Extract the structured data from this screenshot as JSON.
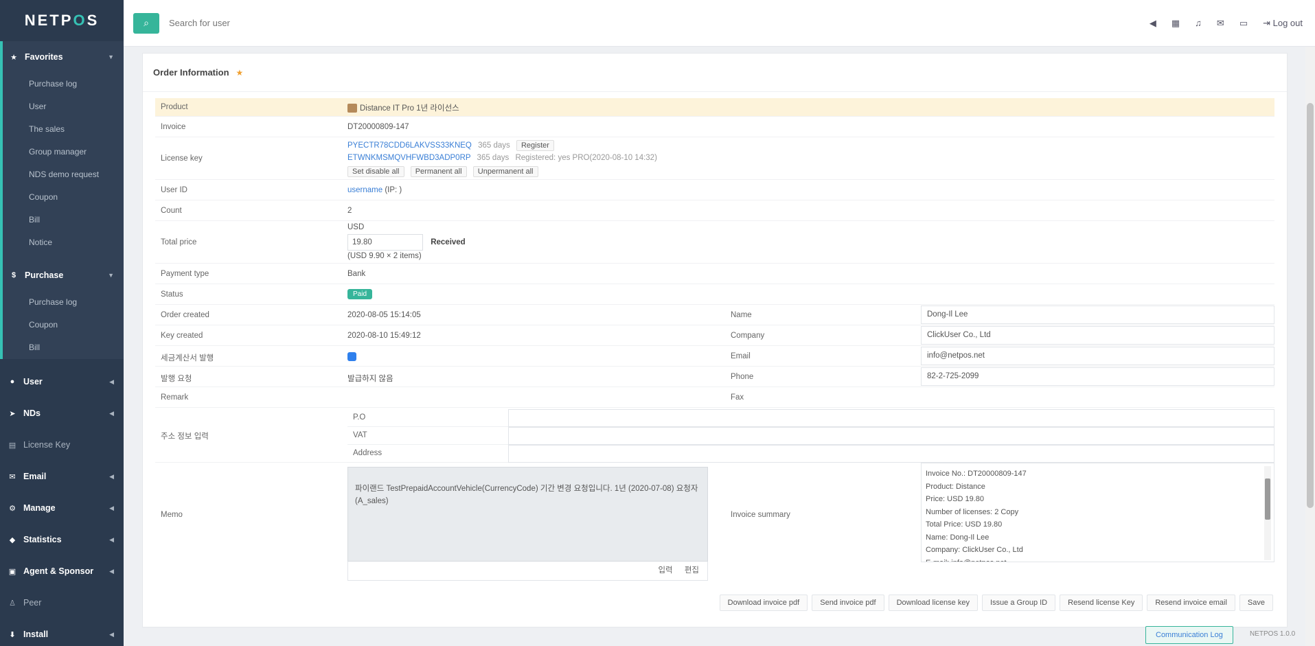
{
  "sidebar": {
    "logo_a": "NETP",
    "logo_b": "O",
    "logo_c": "S",
    "groups": [
      {
        "label": "Favorites",
        "items": [
          "Purchase log",
          "User",
          "The sales",
          "Group manager",
          "NDS demo request",
          "Coupon",
          "Bill",
          "Notice"
        ]
      },
      {
        "label": "Purchase",
        "items": [
          "Purchase log",
          "Coupon",
          "Bill"
        ]
      }
    ],
    "sections": [
      "User",
      "NDs",
      "License Key",
      "Email",
      "Manage",
      "Statistics",
      "Agent & Sponsor",
      "Peer",
      "Install"
    ]
  },
  "topbar": {
    "search_placeholder": "Search for user",
    "logout": "Log out"
  },
  "order": {
    "title": "Order Information",
    "rows": {
      "product_label": "Product",
      "product_value": "Distance IT Pro 1년 라이선스",
      "invoice_label": "Invoice",
      "invoice_value": "DT20000809-147",
      "license_label": "License key",
      "key1": "PYECTR78CDD6LAKVSS33KNEQ",
      "key1_days": "365 days",
      "key1_tag": "Register",
      "key2": "ETWNKMSMQVHFWBD3ADP0RP",
      "key2_days": "365 days",
      "key2_note": "Registered: yes PRO(2020-08-10 14:32)",
      "btn_disable": "Set disable all",
      "btn_perm": "Permanent all",
      "btn_unperm": "Unpermanent all",
      "userid_label": "User ID",
      "userid_value": "username",
      "userid_suffix": "(IP: )",
      "count_label": "Count",
      "count_value": "2",
      "total_label": "Total price",
      "total_currency": "USD",
      "total_amount": "19.80",
      "total_status": "Received",
      "total_note": "(USD 9.90 × 2 items)",
      "payment_label": "Payment type",
      "payment_value": "Bank",
      "status_label": "Status",
      "status_value": "Paid",
      "ordercreated_label": "Order created",
      "ordercreated_value": "2020-08-05 15:14:05",
      "keycreated_label": "Key created",
      "keycreated_value": "2020-08-10 15:49:12",
      "korean1_label": "세금계산서 발행",
      "korean2_label": "발행 요청",
      "korean2_value": "발급하지 않음",
      "remark_label": "Remark",
      "address_label": "주소 정보 입력",
      "addr_p": "P.O",
      "addr_vat": "VAT",
      "addr_addr": "Address",
      "memo_label": "Memo",
      "memo_text": "파이랜드 TestPrepaidAccountVehicle(CurrencyCode) 기간 변경 요청입니다. 1년 (2020-07-08) 요청자(A_sales)",
      "memo_save": "입력",
      "memo_edit": "편집",
      "name_label": "Name",
      "name_value": "Dong-Il Lee",
      "company_label": "Company",
      "company_value": "ClickUser Co., Ltd",
      "email_label": "Email",
      "email_value": "info@netpos.net",
      "phone_label": "Phone",
      "phone_value": "82-2-725-2099",
      "fax_label": "Fax",
      "summary_label": "Invoice summary",
      "summary_lines": [
        "Invoice No.: DT20000809-147",
        "Product: Distance",
        "Price: USD 19.80",
        "Number of licenses: 2 Copy",
        "Total Price: USD 19.80",
        "Name: Dong-Il Lee",
        "Company: ClickUser Co., Ltd",
        "E-mail: info@netpos.net"
      ]
    },
    "actions": [
      "Download invoice pdf",
      "Send invoice pdf",
      "Download license key",
      "Issue a Group ID",
      "Resend license Key",
      "Resend invoice email",
      "Save"
    ]
  },
  "footer": {
    "comm_log": "Communication Log",
    "version": "NETPOS 1.0.0"
  }
}
